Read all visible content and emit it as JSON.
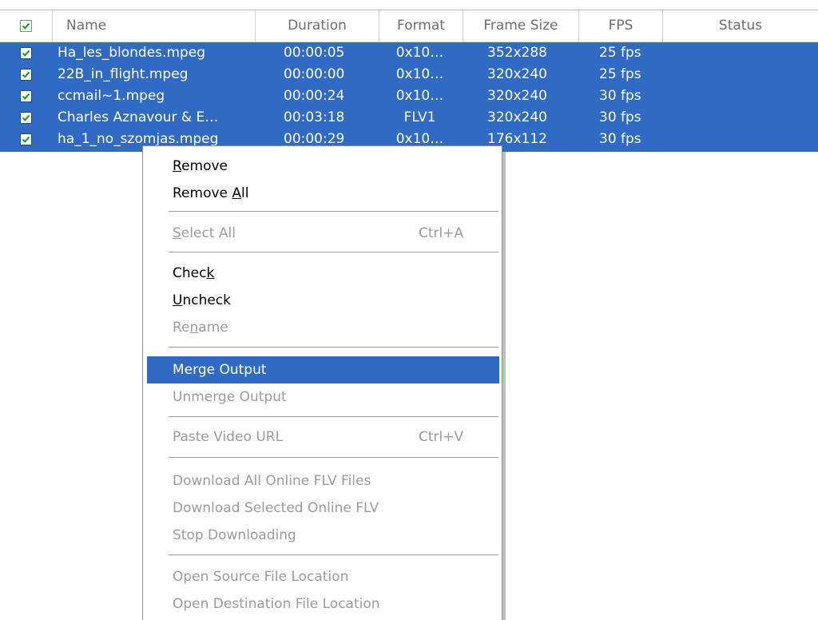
{
  "columns": {
    "name": "Name",
    "duration": "Duration",
    "format": "Format",
    "frame_size": "Frame Size",
    "fps": "FPS",
    "status": "Status"
  },
  "rows": [
    {
      "name": "Ha_les_blondes.mpeg",
      "duration": "00:00:05",
      "format": "0x10…",
      "frame_size": "352x288",
      "fps": "25 fps",
      "status": "",
      "checked": true
    },
    {
      "name": "22B_in_flight.mpeg",
      "duration": "00:00:00",
      "format": "0x10…",
      "frame_size": "320x240",
      "fps": "25 fps",
      "status": "",
      "checked": true
    },
    {
      "name": "ccmail~1.mpeg",
      "duration": "00:00:24",
      "format": "0x10…",
      "frame_size": "320x240",
      "fps": "30 fps",
      "status": "",
      "checked": true
    },
    {
      "name": "Charles Aznavour & E…",
      "duration": "00:03:18",
      "format": "FLV1",
      "frame_size": "320x240",
      "fps": "30 fps",
      "status": "",
      "checked": true
    },
    {
      "name": "ha_1_no_szomjas.mpeg",
      "duration": "00:00:29",
      "format": "0x10…",
      "frame_size": "176x112",
      "fps": "30 fps",
      "status": "",
      "checked": true
    }
  ],
  "menu": {
    "remove": {
      "pre": "",
      "key": "R",
      "post": "emove"
    },
    "remove_all": {
      "pre": "Remove ",
      "key": "A",
      "post": "ll"
    },
    "select_all": {
      "pre": "",
      "key": "S",
      "post": "elect All",
      "shortcut": "Ctrl+A"
    },
    "check": {
      "pre": "Chec",
      "key": "k",
      "post": ""
    },
    "uncheck": {
      "pre": "",
      "key": "U",
      "post": "ncheck"
    },
    "rename": {
      "pre": "Re",
      "key": "n",
      "post": "ame"
    },
    "merge_output": "Merge Output",
    "unmerge_output": "Unmerge Output",
    "paste_video_url": {
      "label": "Paste Video URL",
      "shortcut": "Ctrl+V"
    },
    "download_all": "Download All Online FLV Files",
    "download_selected": "Download Selected Online FLV",
    "stop_downloading": "Stop Downloading",
    "open_source": "Open Source File Location",
    "open_destination": "Open Destination File Location"
  },
  "colors": {
    "selection": "#316ac5",
    "checkbox_tick": "#21a121",
    "disabled_text": "#9c9c9c",
    "header_text": "#6e6e6e"
  },
  "icons": {
    "checkbox": "checkmark-icon"
  }
}
